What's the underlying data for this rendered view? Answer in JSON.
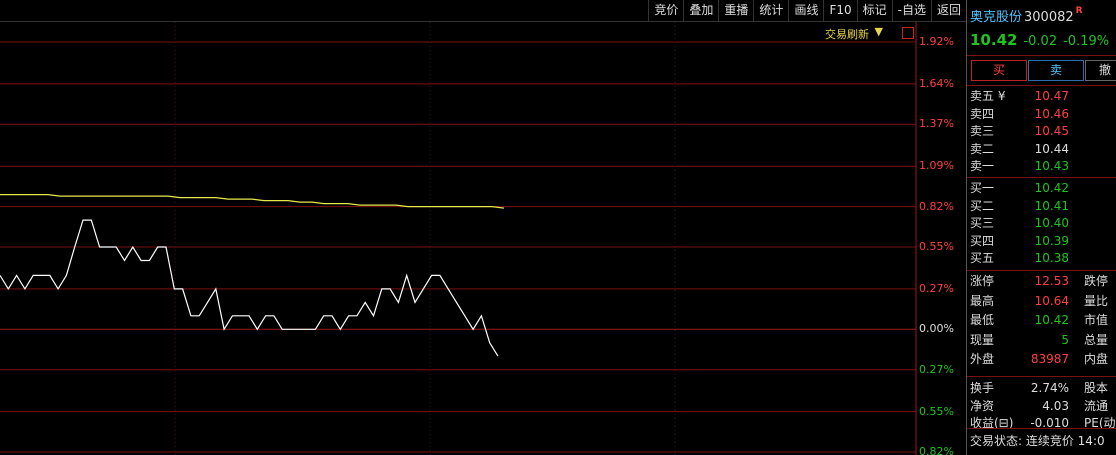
{
  "toolbar": {
    "buttons": [
      "竞价",
      "叠加",
      "重播",
      "统计",
      "画线",
      "F10",
      "标记",
      "-自选",
      "返回"
    ]
  },
  "chart_header": {
    "refresh_label": "交易刷新",
    "refresh_arrow": "▼"
  },
  "chart_data": {
    "type": "line",
    "title": "",
    "pct_labels": [
      {
        "text": "1.92%",
        "value": 1.92,
        "color": "red"
      },
      {
        "text": "1.64%",
        "value": 1.64,
        "color": "red"
      },
      {
        "text": "1.37%",
        "value": 1.37,
        "color": "red"
      },
      {
        "text": "1.09%",
        "value": 1.09,
        "color": "red"
      },
      {
        "text": "0.82%",
        "value": 0.82,
        "color": "red"
      },
      {
        "text": "0.55%",
        "value": 0.55,
        "color": "red"
      },
      {
        "text": "0.27%",
        "value": 0.27,
        "color": "red"
      },
      {
        "text": "0.00%",
        "value": 0.0,
        "color": "white"
      },
      {
        "text": "0.27%",
        "value": -0.27,
        "color": "green"
      },
      {
        "text": "0.55%",
        "value": -0.55,
        "color": "green"
      },
      {
        "text": "0.82%",
        "value": -0.82,
        "color": "green"
      }
    ],
    "ylim": [
      -0.82,
      1.92
    ],
    "x_total": 240,
    "series": [
      {
        "values": [
          0.36,
          0.27,
          0.36,
          0.27,
          0.36,
          0.36,
          0.36,
          0.27,
          0.36,
          0.55,
          0.73,
          0.73,
          0.55,
          0.55,
          0.55,
          0.46,
          0.55,
          0.46,
          0.46,
          0.55,
          0.55,
          0.27,
          0.27,
          0.09,
          0.09,
          0.18,
          0.27,
          0.0,
          0.09,
          0.09,
          0.09,
          0.0,
          0.09,
          0.09,
          0.0,
          0.0,
          0.0,
          0.0,
          0.0,
          0.09,
          0.09,
          0.0,
          0.09,
          0.09,
          0.18,
          0.09,
          0.27,
          0.27,
          0.18,
          0.36,
          0.18,
          0.27,
          0.36,
          0.36,
          0.27,
          0.18,
          0.09,
          0.0,
          0.09,
          -0.09,
          -0.18
        ],
        "color": "#ffffff"
      },
      {
        "values": [
          0.9,
          0.9,
          0.9,
          0.9,
          0.9,
          0.89,
          0.89,
          0.89,
          0.89,
          0.89,
          0.89,
          0.89,
          0.89,
          0.89,
          0.89,
          0.88,
          0.88,
          0.88,
          0.88,
          0.87,
          0.87,
          0.87,
          0.86,
          0.86,
          0.86,
          0.85,
          0.85,
          0.84,
          0.84,
          0.84,
          0.83,
          0.83,
          0.83,
          0.83,
          0.82,
          0.82,
          0.82,
          0.82,
          0.82,
          0.82,
          0.82,
          0.82,
          0.81
        ],
        "color": "#e8e84a"
      }
    ],
    "grid": true,
    "grid_color": "#7a1010"
  },
  "panel": {
    "stock_name": "奥克股份",
    "stock_code": "300082",
    "stock_flag": "R",
    "price": "10.42",
    "change": "-0.02",
    "change_pct": "-0.19%",
    "buy_label": "买",
    "sell_label": "卖",
    "cancel_label": "撤",
    "asks": [
      {
        "label": "卖五 ¥",
        "price": "10.47",
        "color": "red"
      },
      {
        "label": "卖四",
        "price": "10.46",
        "color": "red"
      },
      {
        "label": "卖三",
        "price": "10.45",
        "color": "red"
      },
      {
        "label": "卖二",
        "price": "10.44",
        "color": "white"
      },
      {
        "label": "卖一",
        "price": "10.43",
        "color": "green"
      }
    ],
    "bids": [
      {
        "label": "买一",
        "price": "10.42",
        "color": "green"
      },
      {
        "label": "买二",
        "price": "10.41",
        "color": "green"
      },
      {
        "label": "买三",
        "price": "10.40",
        "color": "green"
      },
      {
        "label": "买四",
        "price": "10.39",
        "color": "green"
      },
      {
        "label": "买五",
        "price": "10.38",
        "color": "green"
      }
    ],
    "stats": [
      {
        "label": "涨停",
        "value": "12.53",
        "color": "red",
        "label2": "跌停"
      },
      {
        "label": "最高",
        "value": "10.64",
        "color": "red",
        "label2": "量比"
      },
      {
        "label": "最低",
        "value": "10.42",
        "color": "green",
        "label2": "市值"
      },
      {
        "label": "现量",
        "value": "5",
        "color": "green",
        "label2": "总量"
      },
      {
        "label": "外盘",
        "value": "83987",
        "color": "red",
        "label2": "内盘"
      }
    ],
    "stats2": [
      {
        "label": "换手",
        "value": "2.74%",
        "color": "white",
        "label2": "股本"
      },
      {
        "label": "净资",
        "value": "4.03",
        "color": "white",
        "label2": "流通"
      },
      {
        "label": "收益(⊟)",
        "value": "-0.010",
        "color": "white",
        "label2": "PE(动"
      }
    ],
    "status": "交易状态: 连续竞价 14:0"
  }
}
